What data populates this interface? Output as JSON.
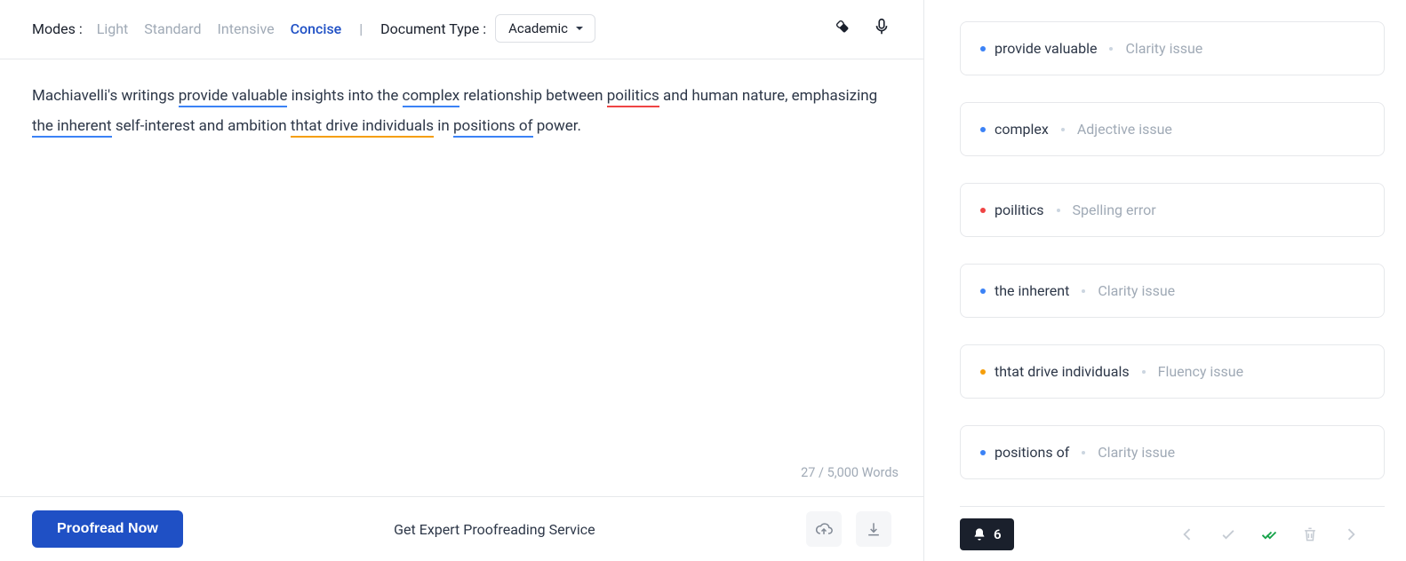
{
  "topbar": {
    "modes_label": "Modes :",
    "modes": [
      "Light",
      "Standard",
      "Intensive",
      "Concise"
    ],
    "active_mode_index": 3,
    "divider": "|",
    "doc_type_label": "Document Type :",
    "doc_type_value": "Academic"
  },
  "editor": {
    "tokens": [
      {
        "text": "Machiavelli's writings "
      },
      {
        "text": "provide valuable",
        "underline": "blue"
      },
      {
        "text": " insights into the "
      },
      {
        "text": "complex",
        "underline": "blue"
      },
      {
        "text": " relationship between "
      },
      {
        "text": "poilitics",
        "underline": "red"
      },
      {
        "text": " and human nature, emphasizing "
      },
      {
        "text": "the inherent",
        "underline": "blue"
      },
      {
        "text": " self-interest and ambition "
      },
      {
        "text": "thtat drive individuals",
        "underline": "orange"
      },
      {
        "text": " in "
      },
      {
        "text": "positions of",
        "underline": "blue"
      },
      {
        "text": " power."
      }
    ],
    "word_count": "27 / 5,000 Words"
  },
  "bottombar": {
    "proofread_label": "Proofread Now",
    "expert_link": "Get Expert Proofreading Service"
  },
  "issues": [
    {
      "phrase": "provide valuable",
      "type": "Clarity issue",
      "color": "blue"
    },
    {
      "phrase": "complex",
      "type": "Adjective issue",
      "color": "blue"
    },
    {
      "phrase": "poilitics",
      "type": "Spelling error",
      "color": "red"
    },
    {
      "phrase": "the inherent",
      "type": "Clarity issue",
      "color": "blue"
    },
    {
      "phrase": "thtat drive individuals",
      "type": "Fluency issue",
      "color": "orange"
    },
    {
      "phrase": "positions of",
      "type": "Clarity issue",
      "color": "blue"
    }
  ],
  "notification_count": "6"
}
